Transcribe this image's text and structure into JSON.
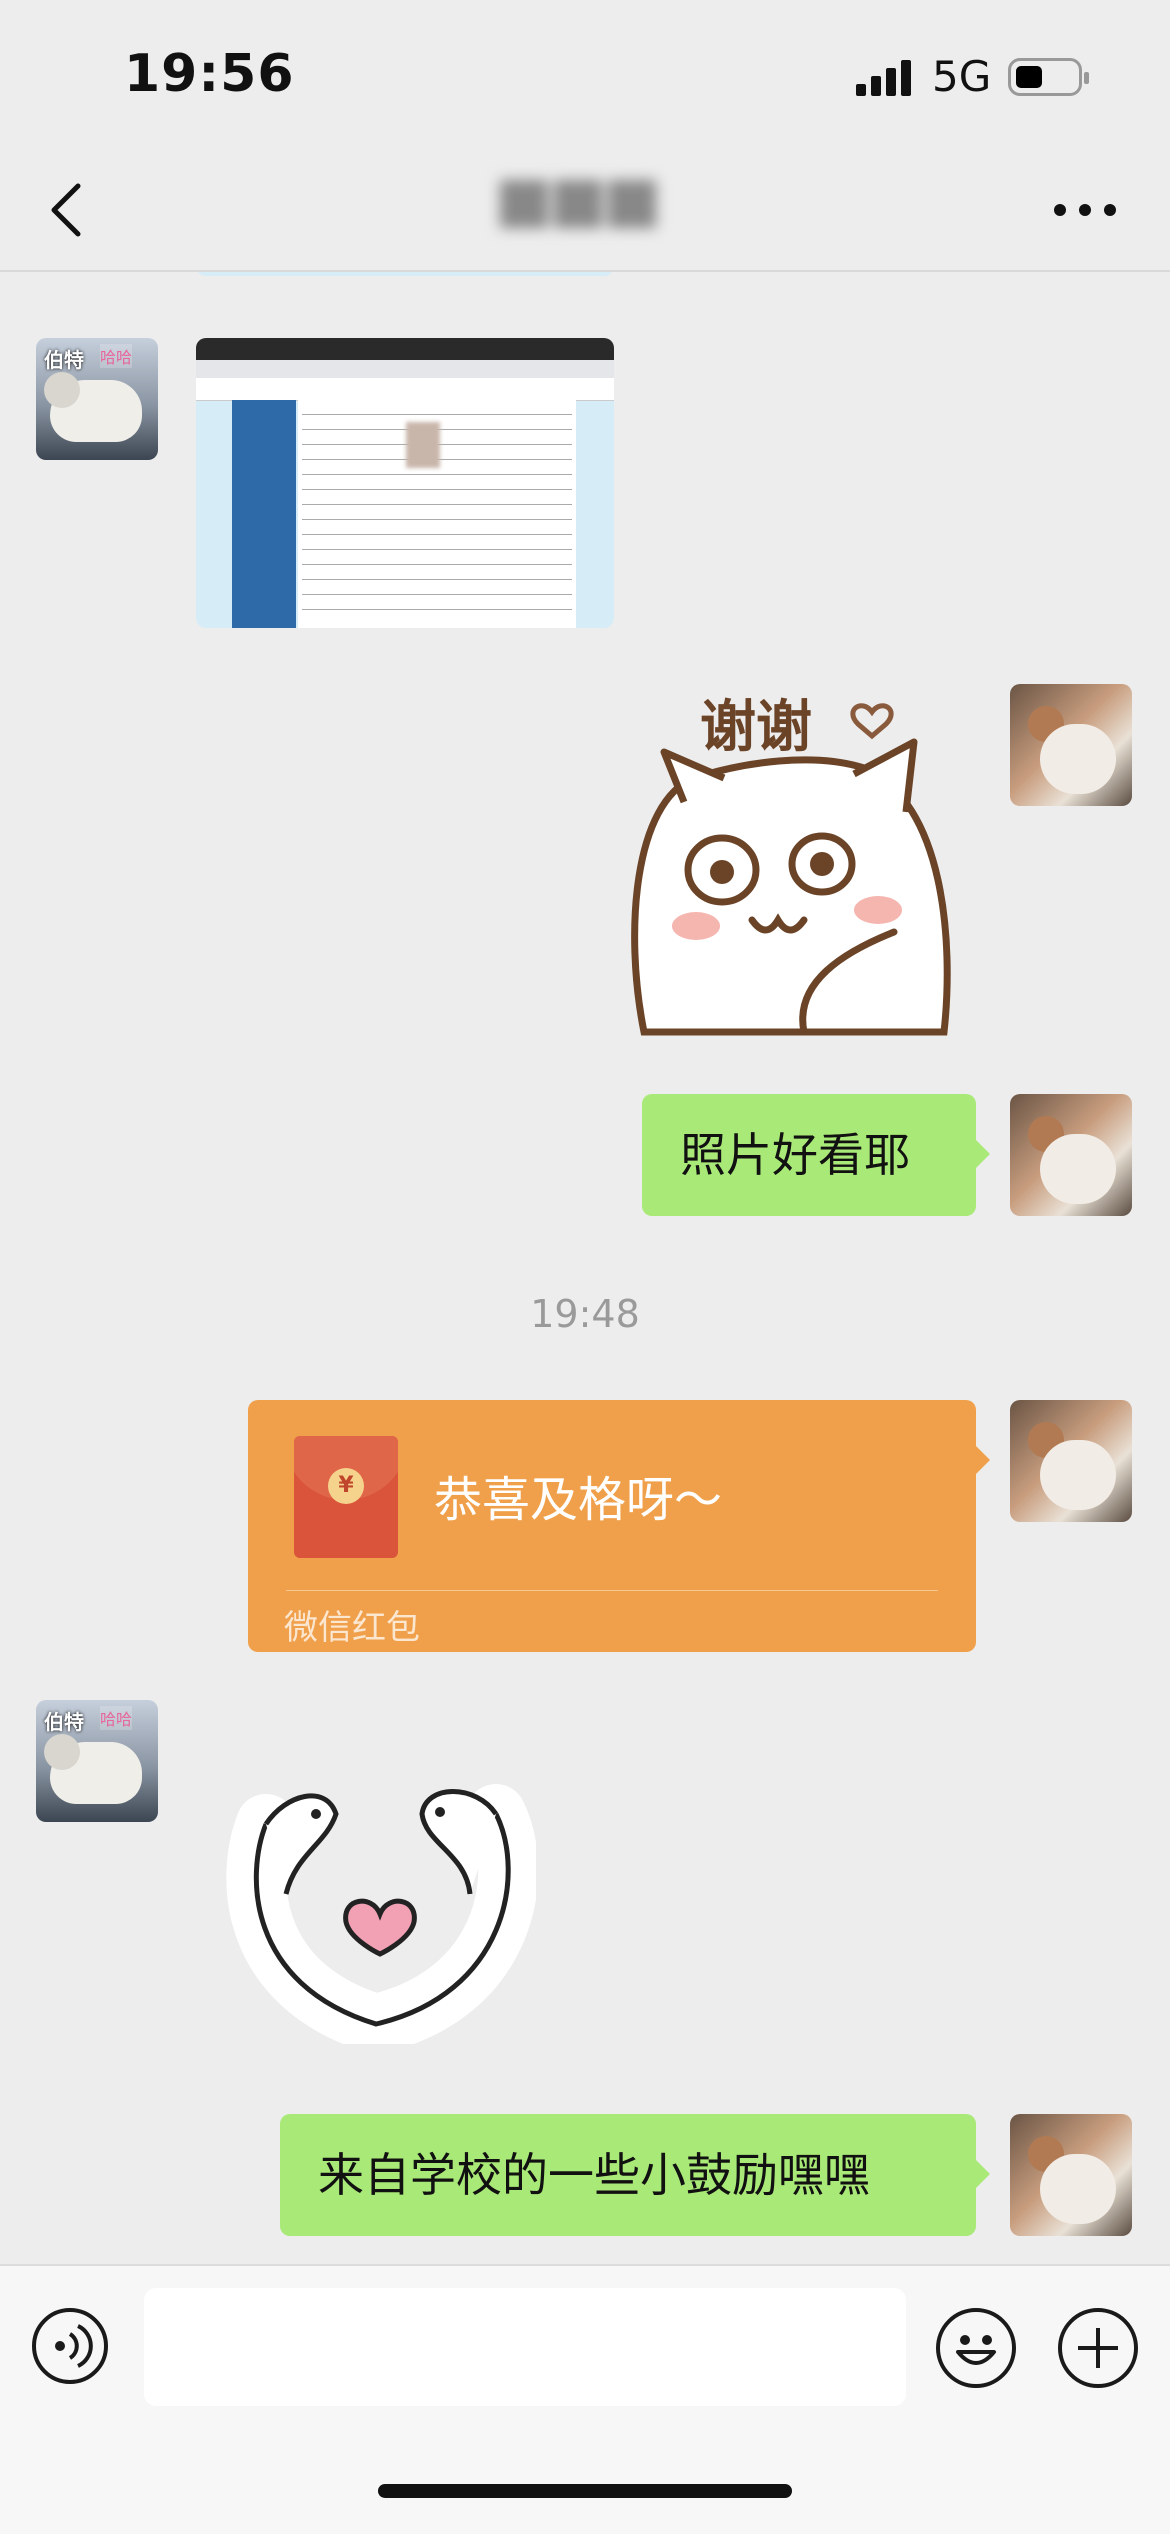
{
  "status": {
    "time": "19:56",
    "network": "5G"
  },
  "nav": {
    "back_icon": "chevron-left-icon",
    "title_blurred": true,
    "more_icon": "ellipsis-icon"
  },
  "messages": [
    {
      "sender": "friend",
      "type": "image",
      "content": "web-page screenshot with form table and blurred ID photo"
    },
    {
      "sender": "me",
      "type": "sticker",
      "label": "谢谢"
    },
    {
      "sender": "me",
      "type": "text",
      "text": "照片好看耶"
    },
    {
      "type": "timestamp",
      "text": "19:48"
    },
    {
      "sender": "me",
      "type": "red_packet",
      "text": "恭喜及格呀～",
      "label": "微信红包"
    },
    {
      "sender": "friend",
      "type": "sticker",
      "label": "heart-hug"
    },
    {
      "sender": "me",
      "type": "text",
      "text": "来自学校的一些小鼓励嘿嘿"
    }
  ],
  "input_bar": {
    "voice_icon": "voice-icon",
    "emoji_icon": "emoji-icon",
    "plus_icon": "plus-icon"
  },
  "colors": {
    "bg": "#ededed",
    "bubble_green": "#a9e977",
    "red_packet": "#f0a04b"
  }
}
